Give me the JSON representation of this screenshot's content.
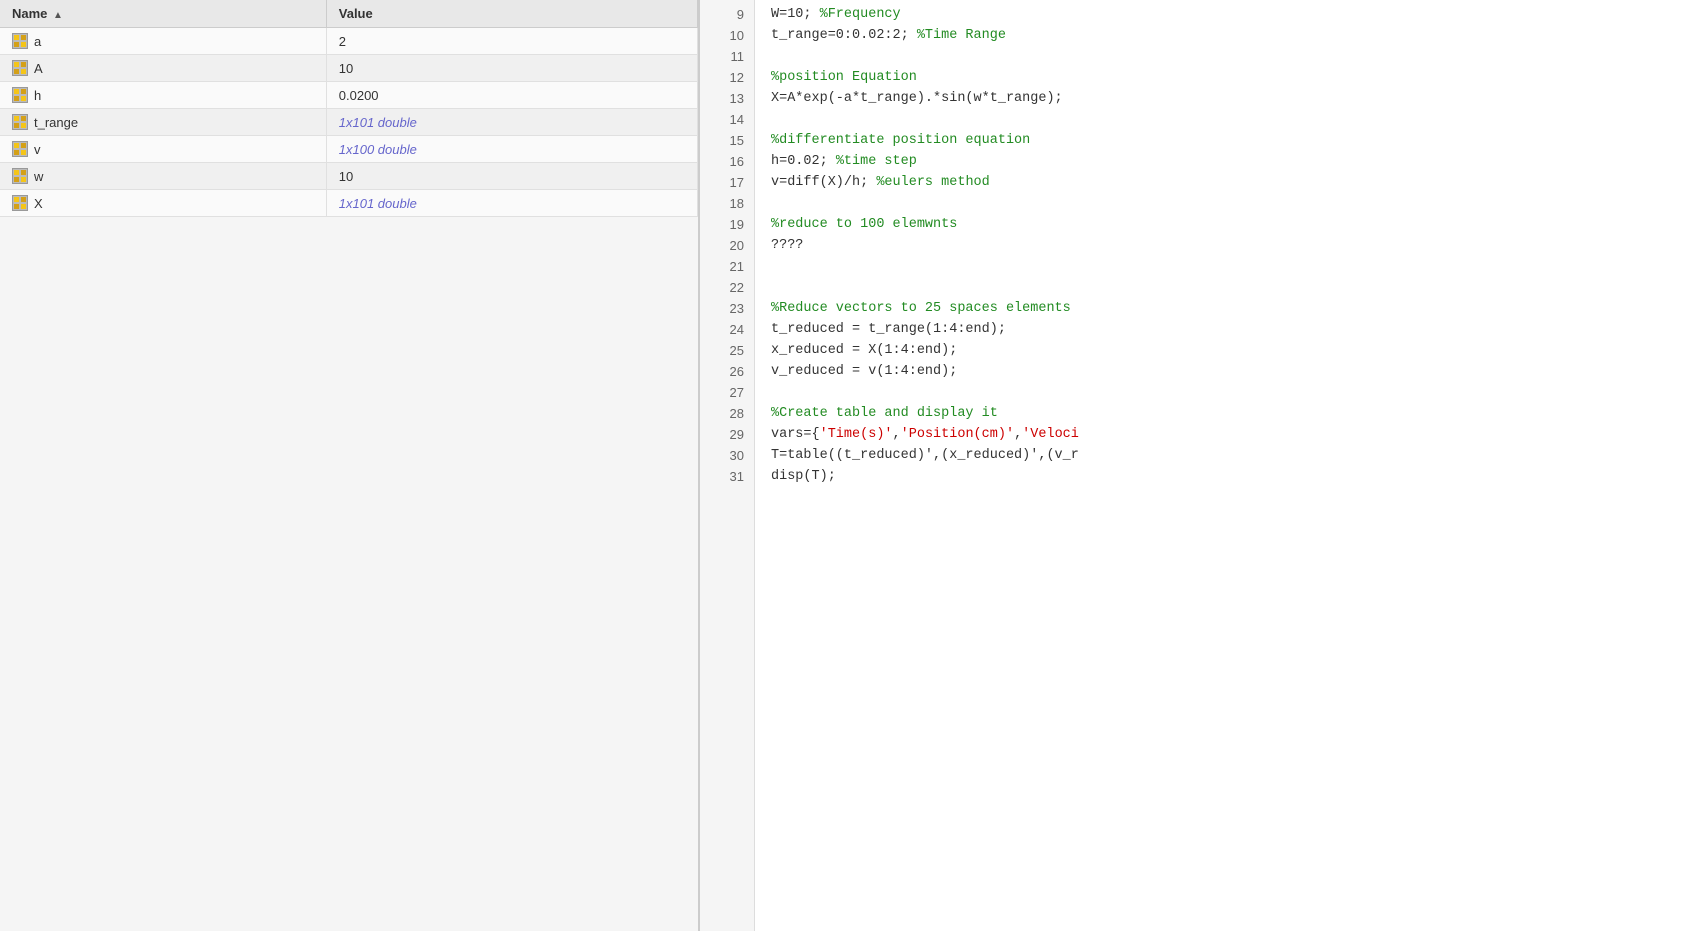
{
  "leftPanel": {
    "columns": [
      {
        "label": "Name",
        "sortable": true
      },
      {
        "label": "Value",
        "sortable": false
      }
    ],
    "variables": [
      {
        "name": "a",
        "value": "2",
        "italic": false
      },
      {
        "name": "A",
        "value": "10",
        "italic": false
      },
      {
        "name": "h",
        "value": "0.0200",
        "italic": false
      },
      {
        "name": "t_range",
        "value": "1x101 double",
        "italic": true
      },
      {
        "name": "v",
        "value": "1x100 double",
        "italic": true
      },
      {
        "name": "w",
        "value": "10",
        "italic": false
      },
      {
        "name": "X",
        "value": "1x101 double",
        "italic": true
      }
    ]
  },
  "codeEditor": {
    "lines": [
      {
        "num": 9,
        "content": "W=10; %Frequency",
        "type": "mixed"
      },
      {
        "num": 10,
        "content": "t_range=0:0.02:2; %Time Range",
        "type": "mixed"
      },
      {
        "num": 11,
        "content": "",
        "type": "empty"
      },
      {
        "num": 12,
        "content": "%position Equation",
        "type": "comment"
      },
      {
        "num": 13,
        "content": "X=A*exp(-a*t_range).*sin(w*t_range);",
        "type": "normal"
      },
      {
        "num": 14,
        "content": "",
        "type": "empty"
      },
      {
        "num": 15,
        "content": "%differentiate position equation",
        "type": "comment"
      },
      {
        "num": 16,
        "content": "h=0.02; %time step",
        "type": "mixed"
      },
      {
        "num": 17,
        "content": "v=diff(X)/h; %eulers method",
        "type": "mixed"
      },
      {
        "num": 18,
        "content": "",
        "type": "empty"
      },
      {
        "num": 19,
        "content": "%reduce to 100 elemwnts",
        "type": "comment"
      },
      {
        "num": 20,
        "content": "????",
        "type": "normal"
      },
      {
        "num": 21,
        "content": "",
        "type": "empty"
      },
      {
        "num": 22,
        "content": "",
        "type": "empty"
      },
      {
        "num": 23,
        "content": "%Reduce vectors to 25 spaces elements",
        "type": "comment"
      },
      {
        "num": 24,
        "content": "t_reduced = t_range(1:4:end);",
        "type": "normal"
      },
      {
        "num": 25,
        "content": "x_reduced = X(1:4:end);",
        "type": "normal"
      },
      {
        "num": 26,
        "content": "v_reduced = v(1:4:end);",
        "type": "normal"
      },
      {
        "num": 27,
        "content": "",
        "type": "empty"
      },
      {
        "num": 28,
        "content": "%Create table and display it",
        "type": "comment"
      },
      {
        "num": 29,
        "content": "vars={'Time(s)','Position(cm)','Veloci",
        "type": "mixed_string"
      },
      {
        "num": 30,
        "content": "T=table((t_reduced)',(x_reduced)',(v_r",
        "type": "normal"
      },
      {
        "num": 31,
        "content": "disp(T);",
        "type": "normal"
      }
    ]
  }
}
